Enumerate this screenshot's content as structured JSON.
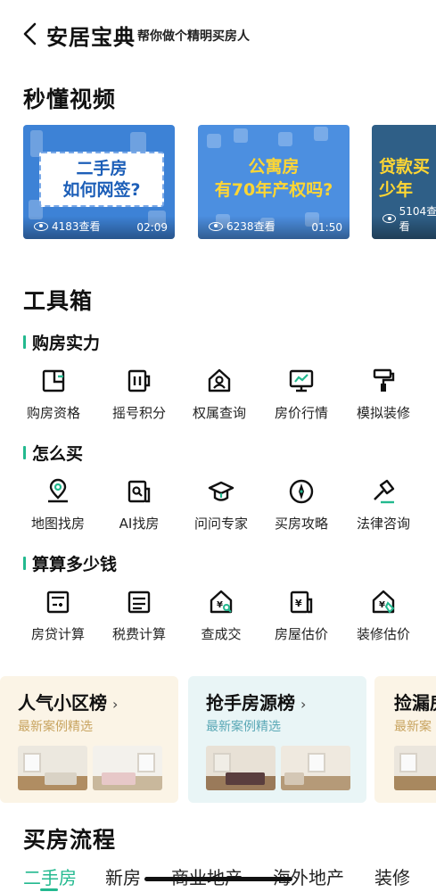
{
  "header": {
    "title": "安居宝典",
    "subtitle": "帮你做个精明买房人"
  },
  "videos_section": {
    "title": "秒懂视频",
    "items": [
      {
        "line1": "二手房",
        "line2": "如何网签?",
        "views": "4183查看",
        "duration": "02:09"
      },
      {
        "line1": "公寓房",
        "line2": "有70年产权吗?",
        "views": "6238查看",
        "duration": "01:50"
      },
      {
        "line1": "贷款买",
        "line2": "少年",
        "views": "5104查看",
        "duration": ""
      }
    ]
  },
  "toolbox": {
    "title": "工具箱",
    "groups": [
      {
        "title": "购房实力",
        "tools": [
          {
            "label": "购房资格",
            "icon": "qualification-icon"
          },
          {
            "label": "摇号积分",
            "icon": "lottery-points-icon"
          },
          {
            "label": "权属查询",
            "icon": "ownership-query-icon"
          },
          {
            "label": "房价行情",
            "icon": "price-trend-icon"
          },
          {
            "label": "模拟装修",
            "icon": "paint-roller-icon"
          }
        ]
      },
      {
        "title": "怎么买",
        "tools": [
          {
            "label": "地图找房",
            "icon": "map-pin-icon"
          },
          {
            "label": "AI找房",
            "icon": "ai-search-icon"
          },
          {
            "label": "问问专家",
            "icon": "graduation-cap-icon"
          },
          {
            "label": "买房攻略",
            "icon": "compass-icon"
          },
          {
            "label": "法律咨询",
            "icon": "gavel-icon"
          }
        ]
      },
      {
        "title": "算算多少钱",
        "tools": [
          {
            "label": "房贷计算",
            "icon": "calculator-icon"
          },
          {
            "label": "税费计算",
            "icon": "tax-icon"
          },
          {
            "label": "查成交",
            "icon": "deal-search-icon"
          },
          {
            "label": "房屋估价",
            "icon": "house-valuation-icon"
          },
          {
            "label": "装修估价",
            "icon": "decoration-valuation-icon"
          }
        ]
      }
    ]
  },
  "ranks": [
    {
      "title": "人气小区榜",
      "sub": "最新案例精选"
    },
    {
      "title": "抢手房源榜",
      "sub": "最新案例精选"
    },
    {
      "title": "捡漏房",
      "sub": "最新案"
    }
  ],
  "process": {
    "title": "买房流程",
    "tabs": [
      "二手房",
      "新房",
      "商业地产",
      "海外地产",
      "装修"
    ],
    "active_tab": "二手房"
  },
  "colors": {
    "accent": "#23b98f",
    "gold": "#c8a460",
    "teal": "#5aa8b6"
  }
}
